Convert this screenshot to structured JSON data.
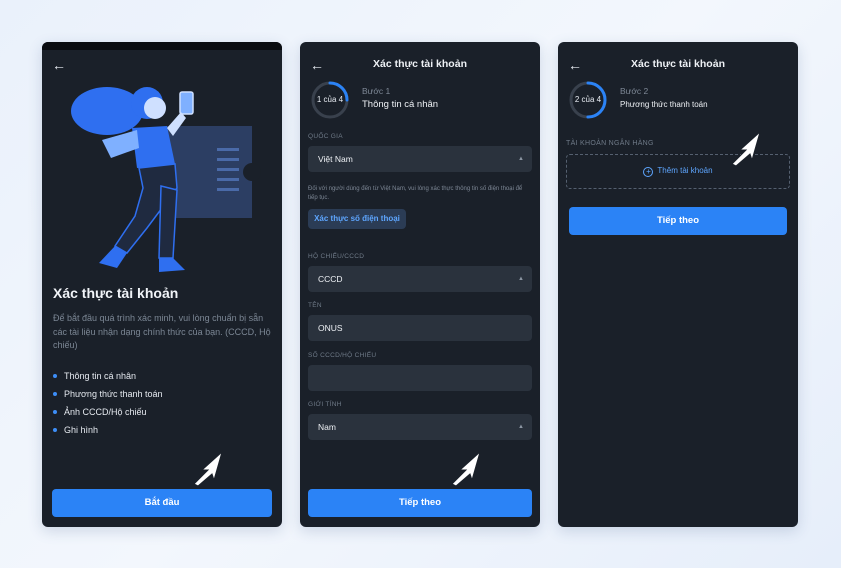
{
  "colors": {
    "accent": "#2b83f6",
    "panel": "#1a2029",
    "field": "#2a323d",
    "link": "#5ea6ff"
  },
  "screen1": {
    "title": "Xác thực tài khoản",
    "description": "Để bắt đầu quá trình xác minh, vui lòng chuẩn bị sẵn các tài liệu nhận dạng chính thức của bạn. (CCCD, Hộ chiếu)",
    "items": [
      "Thông tin cá nhân",
      "Phương thức thanh toán",
      "Ảnh CCCD/Hộ chiếu",
      "Ghi hình"
    ],
    "button": "Bắt đầu"
  },
  "screen2": {
    "header": "Xác thực tài khoản",
    "progress": {
      "text": "1 của 4",
      "fraction": 0.25
    },
    "step_num": "Bước 1",
    "step_name": "Thông tin cá nhân",
    "country_label": "QUỐC GIA",
    "country_value": "Việt Nam",
    "note": "Đối với người dùng đến từ Việt Nam, vui lòng xác thực thông tin số điện thoại để tiếp tục.",
    "verify_button": "Xác thực số điện thoại",
    "id_type_label": "HỘ CHIẾU/CCCD",
    "id_type_value": "CCCD",
    "name_label": "TÊN",
    "name_value": "ONUS",
    "id_number_label": "SỐ CCCD/HỘ CHIẾU",
    "id_number_value": "",
    "gender_label": "GIỚI TÍNH",
    "gender_value": "Nam",
    "button": "Tiếp theo"
  },
  "screen3": {
    "header": "Xác thực tài khoản",
    "progress": {
      "text": "2 của 4",
      "fraction": 0.5
    },
    "step_num": "Bước 2",
    "step_name": "Phương thức thanh toán",
    "bank_label": "TÀI KHOẢN NGÂN HÀNG",
    "add_account": "Thêm tài khoản",
    "button": "Tiếp theo"
  }
}
